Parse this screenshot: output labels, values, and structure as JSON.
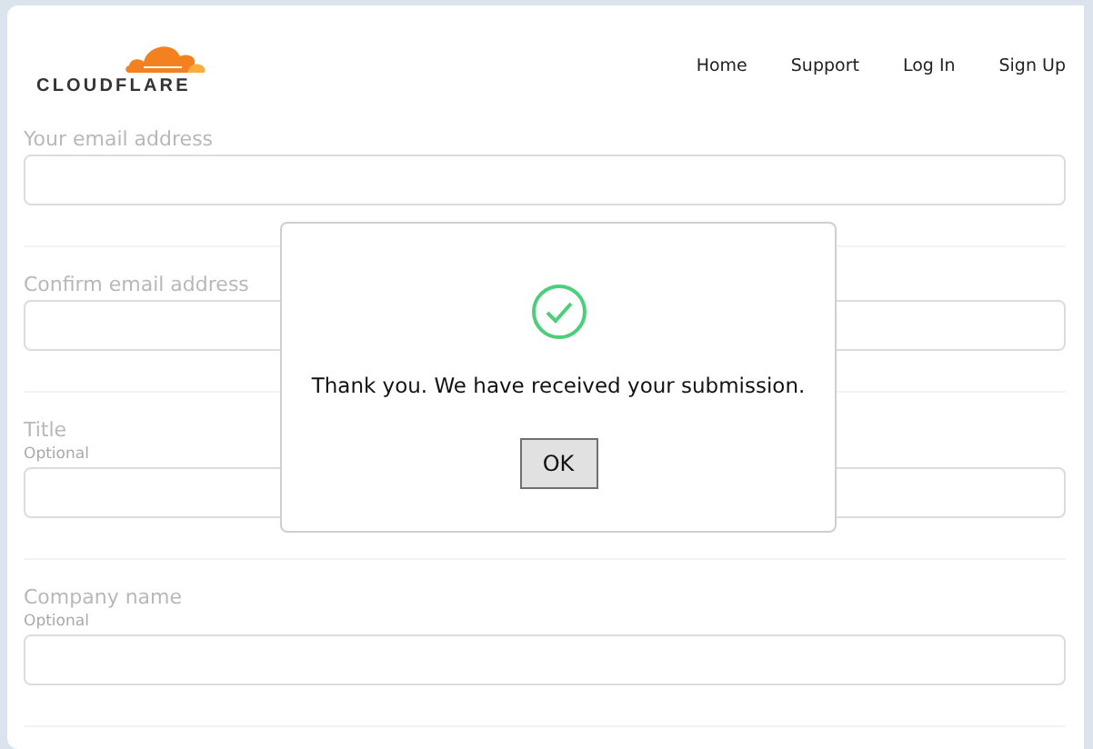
{
  "header": {
    "logo_text": "CLOUDFLARE",
    "nav": [
      "Home",
      "Support",
      "Log In",
      "Sign Up"
    ]
  },
  "form": {
    "fields": [
      {
        "label": "Your email address"
      },
      {
        "label": "Confirm email address"
      },
      {
        "label": "Title",
        "hint": "Optional"
      },
      {
        "label": "Company name",
        "hint": "Optional"
      }
    ]
  },
  "dialog": {
    "message": "Thank you. We have received your submission.",
    "button": "OK"
  }
}
